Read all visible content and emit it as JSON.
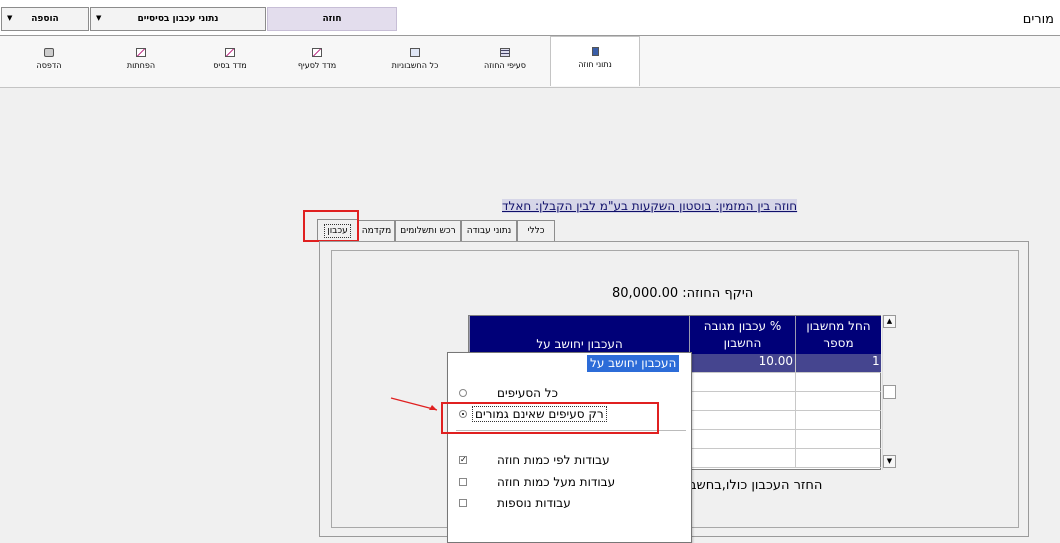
{
  "window": {
    "title": "מורים"
  },
  "topbar": {
    "add_label": "הוספה",
    "retention_label": "נתוני עכבון בסיסיים",
    "contract_label": "חוזה"
  },
  "toolbar": {
    "items": [
      {
        "label": "נתוני חוזה",
        "icon": "book-icon"
      },
      {
        "label": "סעיפי החוזה",
        "icon": "table-icon"
      },
      {
        "label": "כל החשבוניות",
        "icon": "invoice-icon"
      },
      {
        "label": "מדד לסעיף",
        "icon": "chart-icon"
      },
      {
        "label": "מדד בסיס",
        "icon": "chart-icon"
      },
      {
        "label": "הפחתות",
        "icon": "chart-icon"
      },
      {
        "label": "הדפסה",
        "icon": "printer-icon"
      }
    ]
  },
  "contract": {
    "heading": "חוזה בין המזמין: בוסטון השקעות בע\"מ  לבין הקבלן: חאלד"
  },
  "tabs": [
    {
      "label": "כללי"
    },
    {
      "label": "נתוני עבודה"
    },
    {
      "label": "רכש ותשלומים"
    },
    {
      "label": "מקדמה"
    },
    {
      "label": "עכבון"
    }
  ],
  "retention": {
    "scope_label": "היקף החוזה: 80,000.00",
    "grid": {
      "columns": [
        "החל מחשבון מספר",
        "% עכבון מגובה החשבון",
        "העכבון יחושב על"
      ],
      "rows": [
        {
          "from_invoice": "1",
          "percent": "10.00",
          "calc_on": "העכבון יחושב על"
        }
      ]
    },
    "return_text": "החזר העכבון כולו,בחשב"
  },
  "dropdown": {
    "header": "העכבון יחושב על",
    "radio_all": "כל הסעיפים",
    "radio_unfinished": "רק סעיפים שאינם גמורים",
    "check_contract_qty": "עבודות לפי כמות חוזה",
    "check_above_qty": "עבודות מעל כמות חוזה",
    "check_additional": "עבודות נוספות"
  },
  "colors": {
    "grid_header": "#000078",
    "selection": "#2c6cd8",
    "highlight_box": "#e02020"
  }
}
